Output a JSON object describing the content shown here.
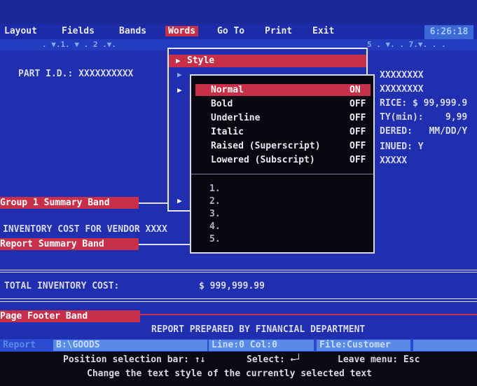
{
  "menubar": {
    "items": [
      "Layout",
      "Fields",
      "Bands",
      "Words",
      "Go To",
      "Print",
      "Exit"
    ],
    "active_index": 3,
    "clock": "6:26:18"
  },
  "ruler": {
    "marks": [
      ". ▼.1. ▼ . 2 .▼.",
      "5 . ▼. . 7.▼. . ."
    ]
  },
  "report": {
    "part_id": "PART I.D.: XXXXXXXXXX",
    "right_fields": [
      "XXXXXXXX",
      "XXXXXXXX",
      "RICE: $ 99,999.9",
      "TY(min):    9,99",
      "DERED:   MM/DD/Y",
      "INUED: Y",
      "XXXXX"
    ],
    "group_band": "Group  1  Summary Band",
    "inventory_line": "INVENTORY COST FOR VENDOR XXXX",
    "report_band": "Report    Summary Band",
    "total_label": "TOTAL INVENTORY COST:",
    "total_value": "$ 999,999.99",
    "page_band": "Page    Footer  Band",
    "footer_text": "REPORT PREPARED BY FINANCIAL DEPARTMENT"
  },
  "words_menu": {
    "title": "Style",
    "arrow": "▶"
  },
  "style_menu": {
    "options": [
      {
        "label": "Normal",
        "state": "ON"
      },
      {
        "label": "Bold",
        "state": "OFF"
      },
      {
        "label": "Underline",
        "state": "OFF"
      },
      {
        "label": "Italic",
        "state": "OFF"
      },
      {
        "label": "Raised (Superscript)",
        "state": "OFF"
      },
      {
        "label": "Lowered (Subscript)",
        "state": "OFF"
      }
    ],
    "selected_index": 0,
    "slots": [
      "1.",
      "2.",
      "3.",
      "4.",
      "5."
    ]
  },
  "status": {
    "mode": "Report",
    "path": "B:\\GOODS",
    "position": "Line:0 Col:0",
    "file": "File:Customer"
  },
  "help": {
    "line1_a": "Position selection bar: ↑↓",
    "line1_b": "Select: ←┘",
    "line1_c": "Leave menu: Esc",
    "line2": "Change the text style of the currently selected text"
  }
}
